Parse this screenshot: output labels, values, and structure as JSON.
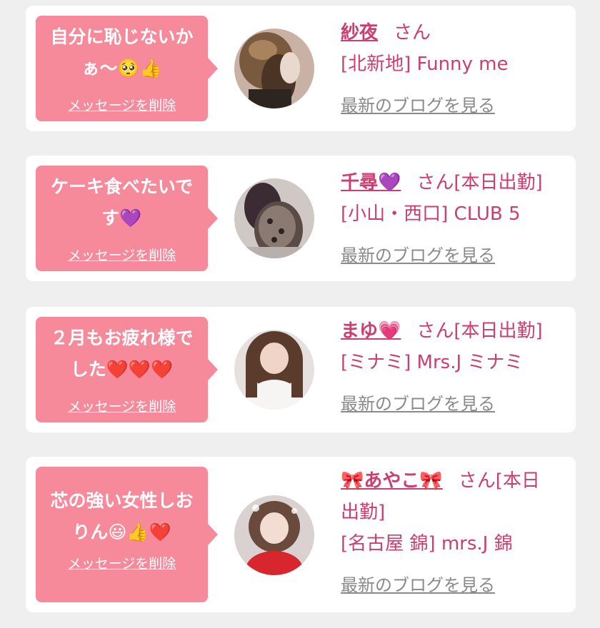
{
  "delete_label": "メッセージを削除",
  "blog_label": "最新のブログを見る",
  "suffix": "さん",
  "colors": {
    "accent": "#f6899a",
    "name": "#cc3d70",
    "link_gray": "#8a8a8a"
  },
  "items": [
    {
      "message_line1": "自分に恥じないか",
      "message_line2": "ぁ〜🥺👍",
      "name": "紗夜",
      "status": "",
      "shop": "[北新地] Funny me",
      "avatar": "woman-hair-blonde"
    },
    {
      "message_line1": "ケーキ食べたいで",
      "message_line2": "す💜",
      "name": "千尋💜",
      "status": "[本日出勤]",
      "shop": "[小山・西口] CLUB 5",
      "avatar": "woman-lace-dress"
    },
    {
      "message_line1": "２月もお疲れ様で",
      "message_line2": "した❤️❤️❤️",
      "name": "まゆ💗",
      "status": "[本日出勤]",
      "shop": "[ミナミ] Mrs.J ミナミ",
      "avatar": "woman-white-top"
    },
    {
      "message_line1": "芯の強い女性しお",
      "message_line2": "りん😃👍❤️",
      "name": "🎀あやこ🎀",
      "status": "[本日",
      "status2": "出勤]",
      "shop": "[名古屋 錦] mrs.J 錦",
      "avatar": "woman-red-dress"
    }
  ]
}
